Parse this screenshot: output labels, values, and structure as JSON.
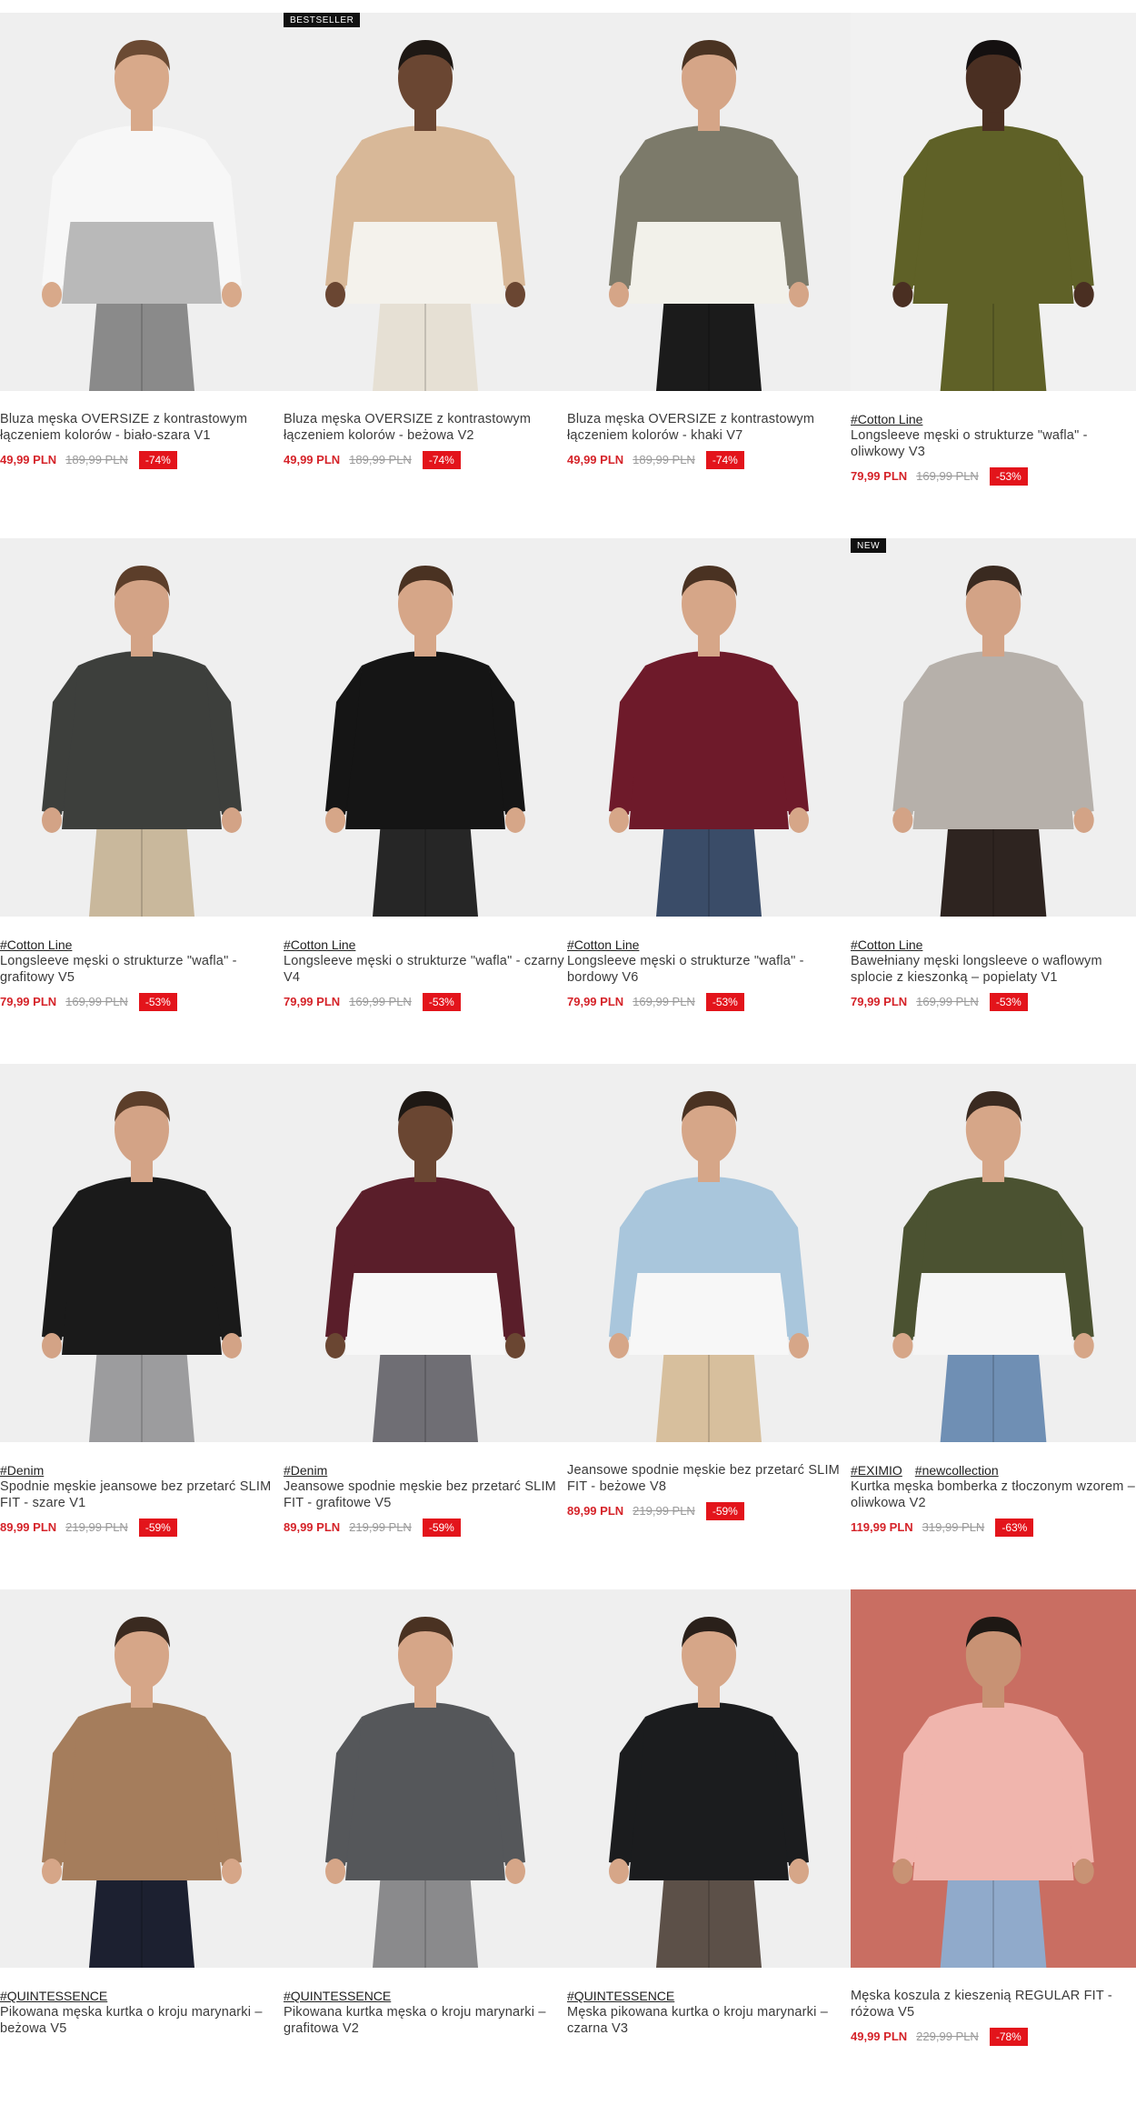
{
  "products": [
    {
      "badge": "",
      "tags": [],
      "name": "Bluza męska OVERSIZE z kontrastowym łączeniem kolorów - biało-szara V1",
      "price": "49,99 PLN",
      "old_price": "189,99 PLN",
      "discount": "-74%",
      "colors": {
        "bg": "#efefef",
        "top": "#f7f7f7",
        "bottom": "#b9b9b9",
        "pants": "#8a8a8a",
        "skin": "#d8a98a",
        "hair": "#6b4a33"
      }
    },
    {
      "badge": "BESTSELLER",
      "tags": [],
      "name": "Bluza męska OVERSIZE z kontrastowym łączeniem kolorów - beżowa V2",
      "price": "49,99 PLN",
      "old_price": "189,99 PLN",
      "discount": "-74%",
      "colors": {
        "bg": "#efefef",
        "top": "#d8b898",
        "bottom": "#f4f2ec",
        "pants": "#e6e0d4",
        "skin": "#6a4632",
        "hair": "#1e1814"
      }
    },
    {
      "badge": "",
      "tags": [],
      "name": "Bluza męska OVERSIZE z kontrastowym łączeniem kolorów - khaki V7",
      "price": "49,99 PLN",
      "old_price": "189,99 PLN",
      "discount": "-74%",
      "colors": {
        "bg": "#efefef",
        "top": "#7c7a6a",
        "bottom": "#f2f1ea",
        "pants": "#1b1b1b",
        "skin": "#d5a587",
        "hair": "#4a3322"
      }
    },
    {
      "badge": "",
      "tags": [
        "#Cotton Line"
      ],
      "name": "Longsleeve męski o strukturze \"wafla\" - oliwkowy V3",
      "price": "79,99 PLN",
      "old_price": "169,99 PLN",
      "discount": "-53%",
      "colors": {
        "bg": "#f1f1f1",
        "top": "#5f6127",
        "bottom": "#5f6127",
        "pants": "#5f6127",
        "skin": "#4a2f22",
        "hair": "#141010"
      }
    },
    {
      "badge": "",
      "tags": [
        "#Cotton Line"
      ],
      "name": "Longsleeve męski o strukturze \"wafla\" - grafitowy V5",
      "price": "79,99 PLN",
      "old_price": "169,99 PLN",
      "discount": "-53%",
      "colors": {
        "bg": "#efefef",
        "top": "#3d3f3c",
        "bottom": "#3d3f3c",
        "pants": "#c9b89c",
        "skin": "#d3a386",
        "hair": "#5c3e2a"
      }
    },
    {
      "badge": "",
      "tags": [
        "#Cotton Line"
      ],
      "name": "Longsleeve męski o strukturze \"wafla\" - czarny V4",
      "price": "79,99 PLN",
      "old_price": "169,99 PLN",
      "discount": "-53%",
      "colors": {
        "bg": "#efefef",
        "top": "#151515",
        "bottom": "#151515",
        "pants": "#262626",
        "skin": "#d6a688",
        "hair": "#4a3222"
      }
    },
    {
      "badge": "",
      "tags": [
        "#Cotton Line"
      ],
      "name": "Longsleeve męski o strukturze \"wafla\" - bordowy V6",
      "price": "79,99 PLN",
      "old_price": "169,99 PLN",
      "discount": "-53%",
      "colors": {
        "bg": "#efefef",
        "top": "#6e1a2a",
        "bottom": "#6e1a2a",
        "pants": "#3a4c68",
        "skin": "#d6a688",
        "hair": "#4a3222"
      }
    },
    {
      "badge": "NEW",
      "tags": [
        "#Cotton Line"
      ],
      "name": "Bawełniany męski longsleeve o waflowym splocie z kieszonką – popielaty V1",
      "price": "79,99 PLN",
      "old_price": "169,99 PLN",
      "discount": "-53%",
      "colors": {
        "bg": "#efefef",
        "top": "#b6b0aa",
        "bottom": "#b6b0aa",
        "pants": "#2e2420",
        "skin": "#d3a386",
        "hair": "#3a2a20"
      }
    },
    {
      "badge": "",
      "tags": [
        "#Denim"
      ],
      "name": "Spodnie męskie jeansowe bez przetarć SLIM FIT - szare V1",
      "price": "89,99 PLN",
      "old_price": "219,99 PLN",
      "discount": "-59%",
      "colors": {
        "bg": "#efefef",
        "top": "#1a1a1a",
        "bottom": "#1a1a1a",
        "pants": "#9c9c9e",
        "skin": "#d3a386",
        "hair": "#5c3e2a"
      }
    },
    {
      "badge": "",
      "tags": [
        "#Denim"
      ],
      "name": "Jeansowe spodnie męskie bez przetarć SLIM FIT - grafitowe V5",
      "price": "89,99 PLN",
      "old_price": "219,99 PLN",
      "discount": "-59%",
      "colors": {
        "bg": "#efefef",
        "top": "#5a1e2a",
        "bottom": "#f7f7f7",
        "pants": "#6f6e74",
        "skin": "#6a4632",
        "hair": "#1e1814"
      }
    },
    {
      "badge": "",
      "tags": [],
      "name": "Jeansowe spodnie męskie bez przetarć SLIM FIT - beżowe V8",
      "price": "89,99 PLN",
      "old_price": "219,99 PLN",
      "discount": "-59%",
      "colors": {
        "bg": "#efefef",
        "top": "#a9c6dc",
        "bottom": "#f7f7f7",
        "pants": "#d7bf9d",
        "skin": "#d6a688",
        "hair": "#4a3222"
      }
    },
    {
      "badge": "",
      "tags": [
        "#EXIMIO",
        "#newcollection"
      ],
      "name": "Kurtka męska bomberka z tłoczonym wzorem – oliwkowa V2",
      "price": "119,99 PLN",
      "old_price": "319,99 PLN",
      "discount": "-63%",
      "colors": {
        "bg": "#efefef",
        "top": "#4b5231",
        "bottom": "#f5f5f5",
        "pants": "#6f8fb4",
        "skin": "#d6a688",
        "hair": "#3a2a20"
      }
    },
    {
      "badge": "",
      "tags": [
        "#QUINTESSENCE"
      ],
      "name": "Pikowana męska kurtka o kroju marynarki – beżowa V5",
      "price": "",
      "old_price": "",
      "discount": "",
      "colors": {
        "bg": "#efefef",
        "top": "#a57d5c",
        "bottom": "#a57d5c",
        "pants": "#1c2030",
        "skin": "#d6a688",
        "hair": "#3a2a20"
      }
    },
    {
      "badge": "",
      "tags": [
        "#QUINTESSENCE"
      ],
      "name": "Pikowana kurtka męska o kroju marynarki – grafitowa V2",
      "price": "",
      "old_price": "",
      "discount": "",
      "colors": {
        "bg": "#efefef",
        "top": "#55575a",
        "bottom": "#55575a",
        "pants": "#8a8a8c",
        "skin": "#d6a688",
        "hair": "#4a3222"
      }
    },
    {
      "badge": "",
      "tags": [
        "#QUINTESSENCE"
      ],
      "name": "Męska pikowana kurtka o kroju marynarki – czarna V3",
      "price": "",
      "old_price": "",
      "discount": "",
      "colors": {
        "bg": "#efefef",
        "top": "#1b1c1e",
        "bottom": "#1b1c1e",
        "pants": "#5c5048",
        "skin": "#d6a688",
        "hair": "#2a201a"
      }
    },
    {
      "badge": "",
      "tags": [],
      "name": "Męska koszula z kieszenią REGULAR FIT - różowa V5",
      "price": "49,99 PLN",
      "old_price": "229,99 PLN",
      "discount": "-78%",
      "colors": {
        "bg": "#c96e62",
        "top": "#f0b5ad",
        "bottom": "#f0b5ad",
        "pants": "#90aacb",
        "skin": "#c89274",
        "hair": "#1e1814"
      }
    }
  ]
}
